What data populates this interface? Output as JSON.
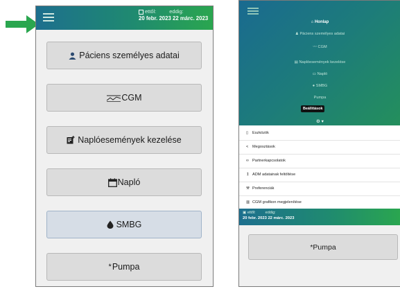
{
  "colors": {
    "header_start": "#1d6f8e",
    "header_end": "#2aa64f",
    "arrow": "#2aa64f",
    "button_bg": "#dcdcdc"
  },
  "left_screen": {
    "header": {
      "from_label": "ettől:",
      "to_label": "eddig:",
      "from_value": "20 febr. 2023",
      "to_value": "22 márc. 2023"
    },
    "buttons": [
      {
        "icon": "person-icon",
        "label": "Páciens személyes adatai"
      },
      {
        "icon": "cgm-icon",
        "label": "CGM"
      },
      {
        "icon": "note-add-icon",
        "label": "Naplóesemények kezelése"
      },
      {
        "icon": "calendar-icon",
        "label": "Napló"
      },
      {
        "icon": "drop-icon",
        "label": "SMBG"
      },
      {
        "icon": "asterisk-icon",
        "label": "Pumpa"
      }
    ]
  },
  "right_screen": {
    "menu": [
      {
        "icon": "home-icon",
        "label": "Honlap"
      },
      {
        "icon": "person-icon",
        "label": "Páciens személyes adatai"
      },
      {
        "icon": "cgm-icon",
        "label": "CGM"
      },
      {
        "icon": "note-add-icon",
        "label": "Naplóesemények kezelése"
      },
      {
        "icon": "calendar-icon",
        "label": "Napló"
      },
      {
        "icon": "drop-icon",
        "label": "SMBG"
      },
      {
        "icon": "",
        "label": "Pumpa"
      },
      {
        "icon": "file-icon",
        "label": "k"
      }
    ],
    "tooltip": "Beállítások",
    "settings_glyph": "⚙ ▾",
    "dropdown": [
      {
        "icon": "tools-icon",
        "label": "Eszközök"
      },
      {
        "icon": "share-icon",
        "label": "Megosztások"
      },
      {
        "icon": "link-icon",
        "label": "Partnerkapcsolatok"
      },
      {
        "icon": "upload-icon",
        "label": "ADM adatainak feltöltése"
      },
      {
        "icon": "wrench-icon",
        "label": "Preferenciák"
      },
      {
        "icon": "chart-icon",
        "label": "CGM grafikon megjelenítése"
      }
    ],
    "header": {
      "from_label": "ettől:",
      "to_label": "eddig:",
      "from_value": "20 febr. 2023",
      "to_value": "22 márc. 2023"
    },
    "bottom_button": {
      "icon": "asterisk-icon",
      "label": "Pumpa"
    }
  }
}
